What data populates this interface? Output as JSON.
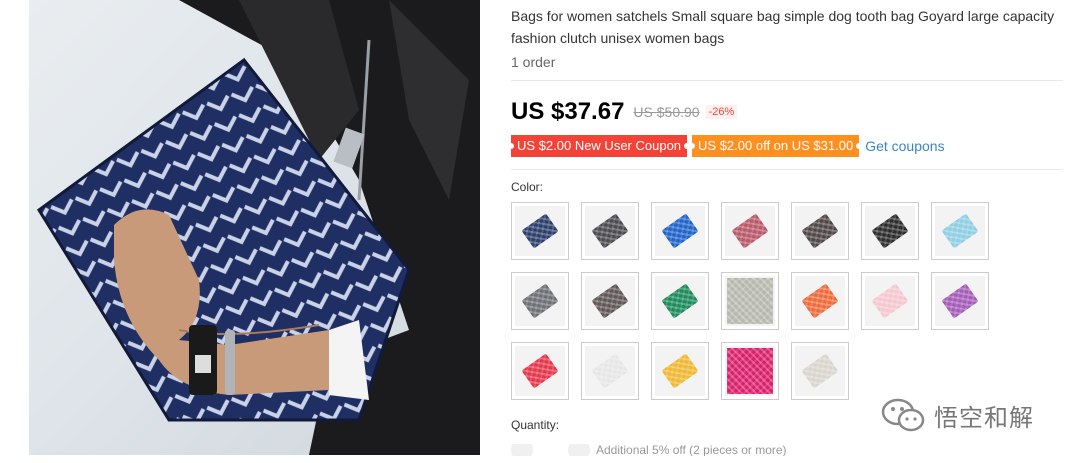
{
  "product": {
    "title": "Bags for women satchels Small square bag simple dog tooth bag Goyard large capacity fashion clutch unisex women bags",
    "orders": "1 order",
    "price": "US $37.67",
    "old_price": "US $50.90",
    "discount": "-26%"
  },
  "coupons": {
    "new_user": "US $2.00 New User Coupon",
    "store": "US $2.00 off on US $31.00",
    "get_coupons": "Get coupons"
  },
  "color": {
    "label": "Color:",
    "swatches": [
      {
        "name": "navy",
        "color": "#2b3d6b"
      },
      {
        "name": "dark-gray",
        "color": "#4a4a4f"
      },
      {
        "name": "blue",
        "color": "#1e63c9"
      },
      {
        "name": "rose",
        "color": "#b85868"
      },
      {
        "name": "charcoal",
        "color": "#4f4545"
      },
      {
        "name": "black",
        "color": "#2c2c2c"
      },
      {
        "name": "sky-blue",
        "color": "#8fcde3"
      },
      {
        "name": "gray",
        "color": "#6c6f75"
      },
      {
        "name": "brown-gray",
        "color": "#5e5555"
      },
      {
        "name": "green",
        "color": "#1b8a5a"
      },
      {
        "name": "gray-photo",
        "color": "#b5b8ae"
      },
      {
        "name": "orange",
        "color": "#ef6a3a"
      },
      {
        "name": "pink",
        "color": "#f4c7cf"
      },
      {
        "name": "purple",
        "color": "#a35bb7"
      },
      {
        "name": "red",
        "color": "#e5354a"
      },
      {
        "name": "white",
        "color": "#e6e6e6"
      },
      {
        "name": "yellow",
        "color": "#f0b733"
      },
      {
        "name": "magenta-photo",
        "color": "#d91e6a"
      },
      {
        "name": "cream",
        "color": "#d8d5cc"
      }
    ]
  },
  "quantity": {
    "label": "Quantity:",
    "note": "Additional 5% off (2 pieces or more)"
  },
  "watermark": {
    "text": "悟空和解"
  }
}
